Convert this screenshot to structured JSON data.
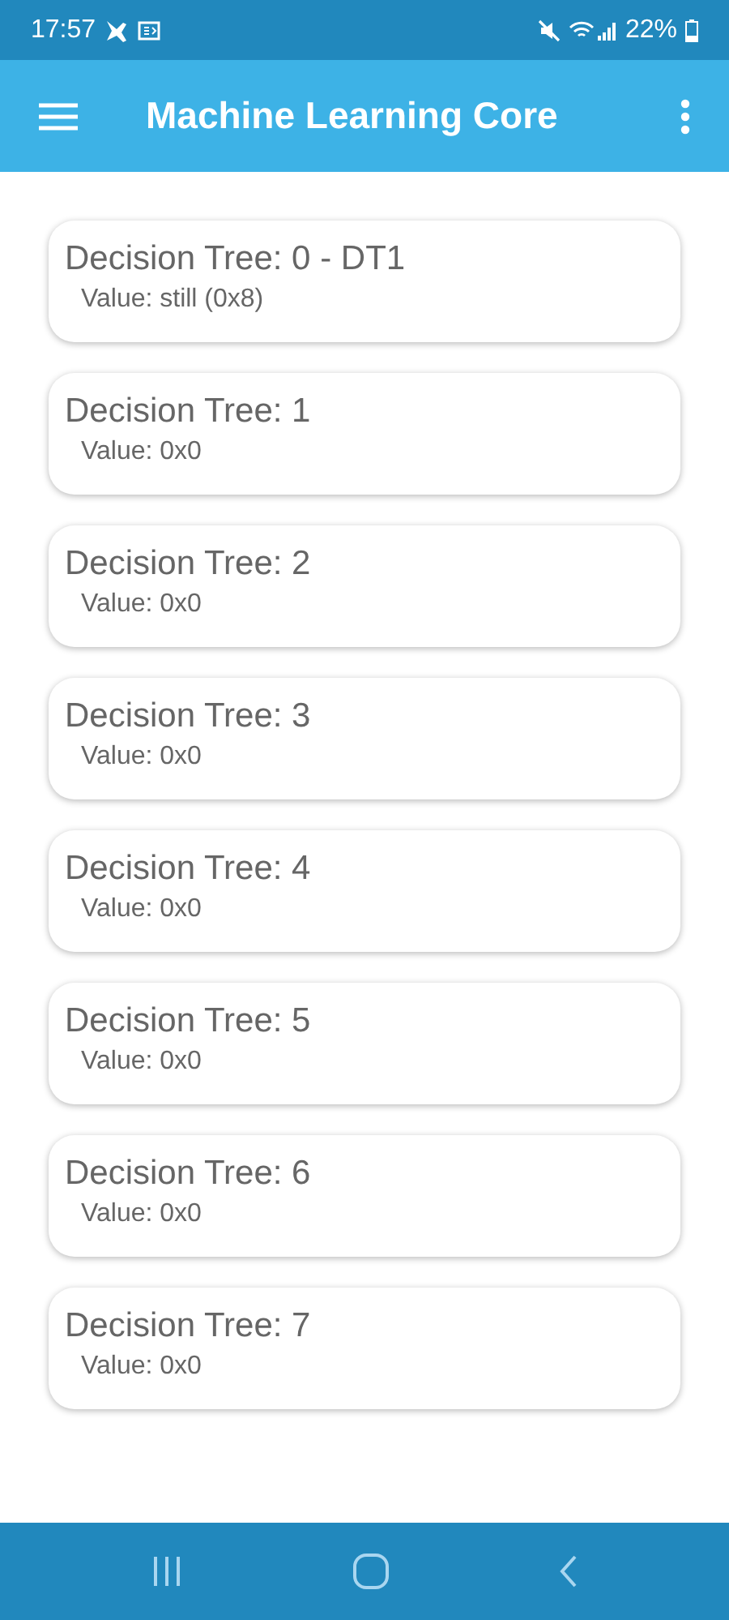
{
  "status_bar": {
    "time": "17:57",
    "battery": "22%"
  },
  "app_bar": {
    "title": "Machine Learning Core"
  },
  "trees": [
    {
      "title": "Decision Tree: 0 - DT1",
      "value": "Value: still (0x8)"
    },
    {
      "title": "Decision Tree: 1",
      "value": "Value: 0x0"
    },
    {
      "title": "Decision Tree: 2",
      "value": "Value: 0x0"
    },
    {
      "title": "Decision Tree: 3",
      "value": "Value: 0x0"
    },
    {
      "title": "Decision Tree: 4",
      "value": "Value: 0x0"
    },
    {
      "title": "Decision Tree: 5",
      "value": "Value: 0x0"
    },
    {
      "title": "Decision Tree: 6",
      "value": "Value: 0x0"
    },
    {
      "title": "Decision Tree: 7",
      "value": "Value: 0x0"
    }
  ]
}
